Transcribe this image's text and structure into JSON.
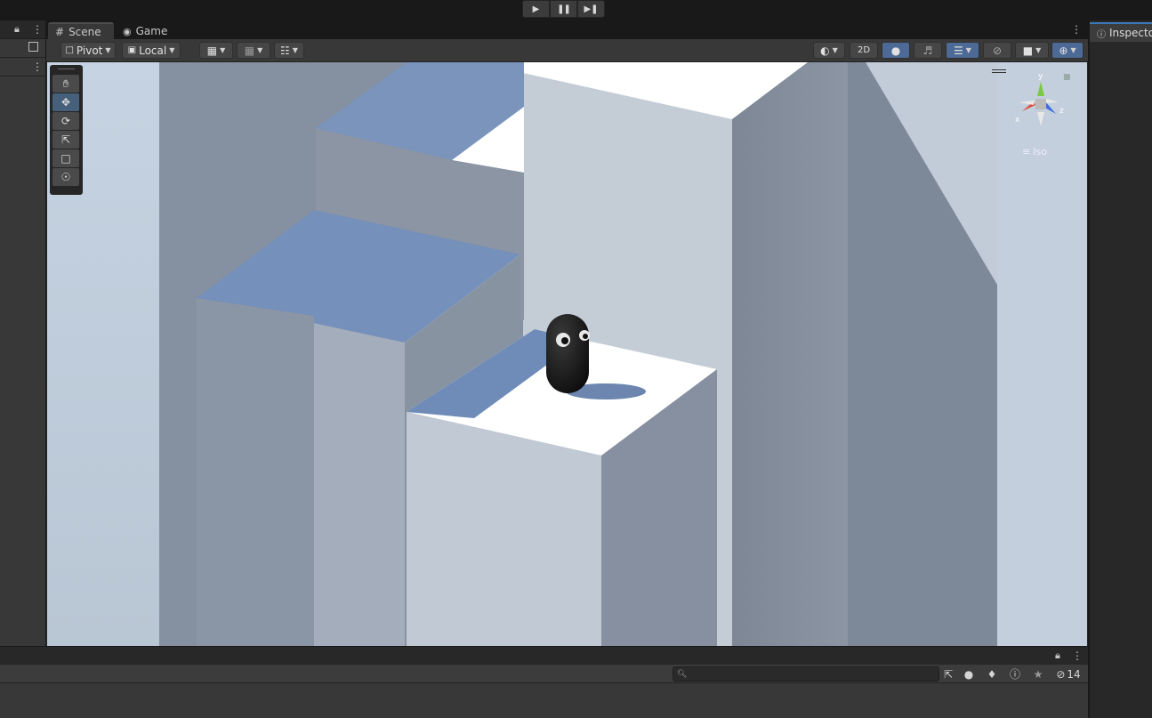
{
  "playbar": {
    "play_icon": "play-icon",
    "pause_icon": "pause-icon",
    "step_icon": "step-icon"
  },
  "scene_tabs": [
    {
      "label": "Scene",
      "icon": "grid-icon",
      "active": true
    },
    {
      "label": "Game",
      "icon": "gamepad-icon",
      "active": false
    }
  ],
  "toolbar": {
    "pivot_label": "Pivot",
    "local_label": "Local",
    "mode_2d_label": "2D"
  },
  "tools": [
    "hand-tool",
    "move-tool",
    "rotate-tool",
    "scale-tool",
    "rect-tool",
    "transform-tool"
  ],
  "gizmo": {
    "y_label": "y",
    "z_label": "z",
    "x_label": "x",
    "projection_label": "Iso"
  },
  "inspector": {
    "tab_label": "Inspecto"
  },
  "console": {
    "search_placeholder": "",
    "hidden_count": "14"
  },
  "colors": {
    "accent": "#3a79bb",
    "selected_tool": "#46607c",
    "toggle_on": "#4c6a95",
    "sky": "#c7d3e0"
  }
}
